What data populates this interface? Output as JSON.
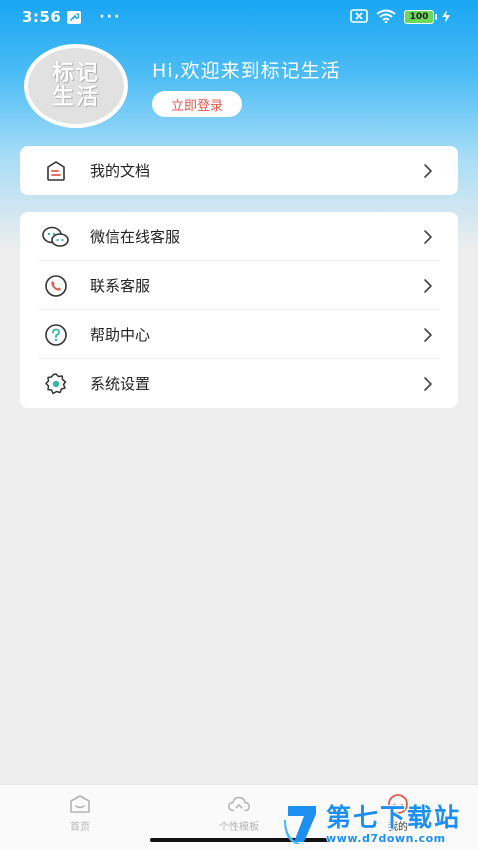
{
  "status_bar": {
    "time": "3:56",
    "dots": "···",
    "battery": "100"
  },
  "profile": {
    "avatar_text": "标记生活",
    "greeting": "Hi,欢迎来到标记生活",
    "login_label": "立即登录"
  },
  "menu_docs": [
    {
      "label": "我的文档",
      "icon": "document-icon"
    }
  ],
  "menu_services": [
    {
      "label": "微信在线客服",
      "icon": "wechat-icon"
    },
    {
      "label": "联系客服",
      "icon": "phone-icon"
    },
    {
      "label": "帮助中心",
      "icon": "help-icon"
    },
    {
      "label": "系统设置",
      "icon": "settings-icon"
    }
  ],
  "bottom_nav": [
    {
      "label": "首页",
      "icon": "home-icon",
      "active": false
    },
    {
      "label": "个性模板",
      "icon": "cloud-icon",
      "active": false
    },
    {
      "label": "我的",
      "icon": "smile-icon",
      "active": true
    }
  ],
  "watermark": {
    "title": "第七下载站",
    "url": "www.d7down.com"
  },
  "colors": {
    "header_blue": "#19a6f3",
    "accent_red": "#e15a4c",
    "icon_teal": "#36b5a6",
    "watermark_blue": "#1c8ff0"
  }
}
